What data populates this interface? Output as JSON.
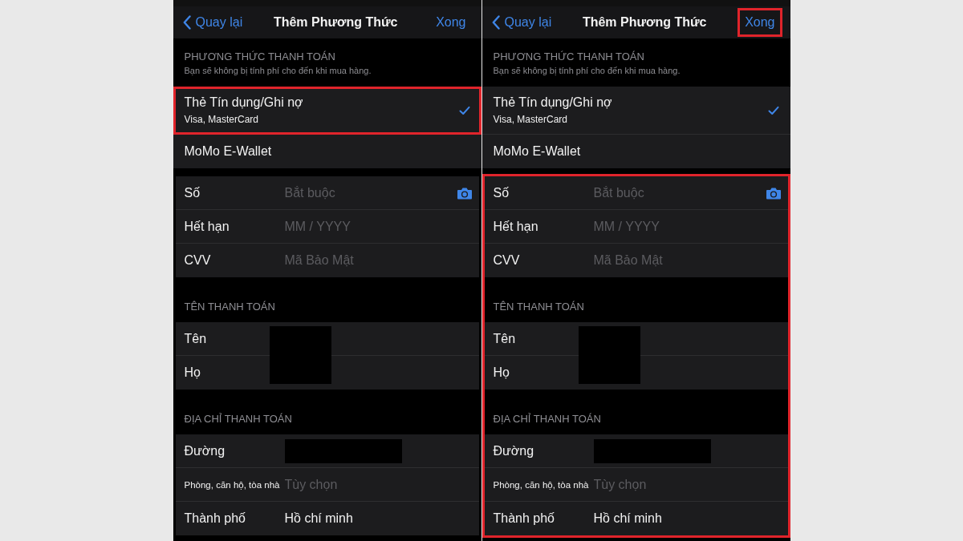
{
  "screens": [
    {
      "nav": {
        "back": "Quay lại",
        "title": "Thêm Phương Thức",
        "done": "Xong",
        "done_highlighted": false
      },
      "payment_section": {
        "title": "PHƯƠNG THỨC THANH TOÁN",
        "note": "Bạn sẽ không bị tính phí cho đến khi mua hàng.",
        "methods": [
          {
            "name": "Thẻ Tín dụng/Ghi nợ",
            "detail": "Visa, MasterCard",
            "selected": true,
            "highlighted": true
          },
          {
            "name": "MoMo E-Wallet",
            "selected": false,
            "highlighted": false
          }
        ]
      },
      "form_highlighted": false,
      "groups": [
        {
          "redacted": false,
          "fields": [
            {
              "label": "Số",
              "placeholder": "Bắt buộc",
              "kind": "camera"
            },
            {
              "label": "Hết hạn",
              "placeholder": "MM / YYYY",
              "kind": "text"
            },
            {
              "label": "CVV",
              "placeholder": "Mã Bảo Mật",
              "kind": "text"
            }
          ]
        },
        {
          "title": "TÊN THANH TOÁN",
          "redacted": true,
          "fields": [
            {
              "label": "Tên",
              "kind": "blank"
            },
            {
              "label": "Họ",
              "kind": "blank"
            }
          ]
        },
        {
          "title": "ĐỊA CHỈ THANH TOÁN",
          "redacted": false,
          "fields": [
            {
              "label": "Đường",
              "kind": "redacted"
            },
            {
              "label": "Phòng, căn hộ, tòa nhà",
              "placeholder": "Tùy chọn",
              "kind": "text"
            },
            {
              "label": "Thành phố",
              "value": "Hồ chí minh",
              "kind": "text"
            }
          ]
        }
      ]
    },
    {
      "nav": {
        "back": "Quay lại",
        "title": "Thêm Phương Thức",
        "done": "Xong",
        "done_highlighted": true
      },
      "payment_section": {
        "title": "PHƯƠNG THỨC THANH TOÁN",
        "note": "Bạn sẽ không bị tính phí cho đến khi mua hàng.",
        "methods": [
          {
            "name": "Thẻ Tín dụng/Ghi nợ",
            "detail": "Visa, MasterCard",
            "selected": true,
            "highlighted": false
          },
          {
            "name": "MoMo E-Wallet",
            "selected": false,
            "highlighted": false
          }
        ]
      },
      "form_highlighted": true,
      "groups": [
        {
          "redacted": false,
          "fields": [
            {
              "label": "Số",
              "placeholder": "Bắt buộc",
              "kind": "camera"
            },
            {
              "label": "Hết hạn",
              "placeholder": "MM / YYYY",
              "kind": "text"
            },
            {
              "label": "CVV",
              "placeholder": "Mã Bảo Mật",
              "kind": "text"
            }
          ]
        },
        {
          "title": "TÊN THANH TOÁN",
          "redacted": true,
          "fields": [
            {
              "label": "Tên",
              "kind": "blank"
            },
            {
              "label": "Họ",
              "kind": "blank"
            }
          ]
        },
        {
          "title": "ĐỊA CHỈ THANH TOÁN",
          "redacted": false,
          "fields": [
            {
              "label": "Đường",
              "kind": "redacted"
            },
            {
              "label": "Phòng, căn hộ, tòa nhà",
              "placeholder": "Tùy chọn",
              "kind": "text"
            },
            {
              "label": "Thành phố",
              "value": "Hồ chí minh",
              "kind": "text"
            }
          ]
        }
      ]
    }
  ]
}
